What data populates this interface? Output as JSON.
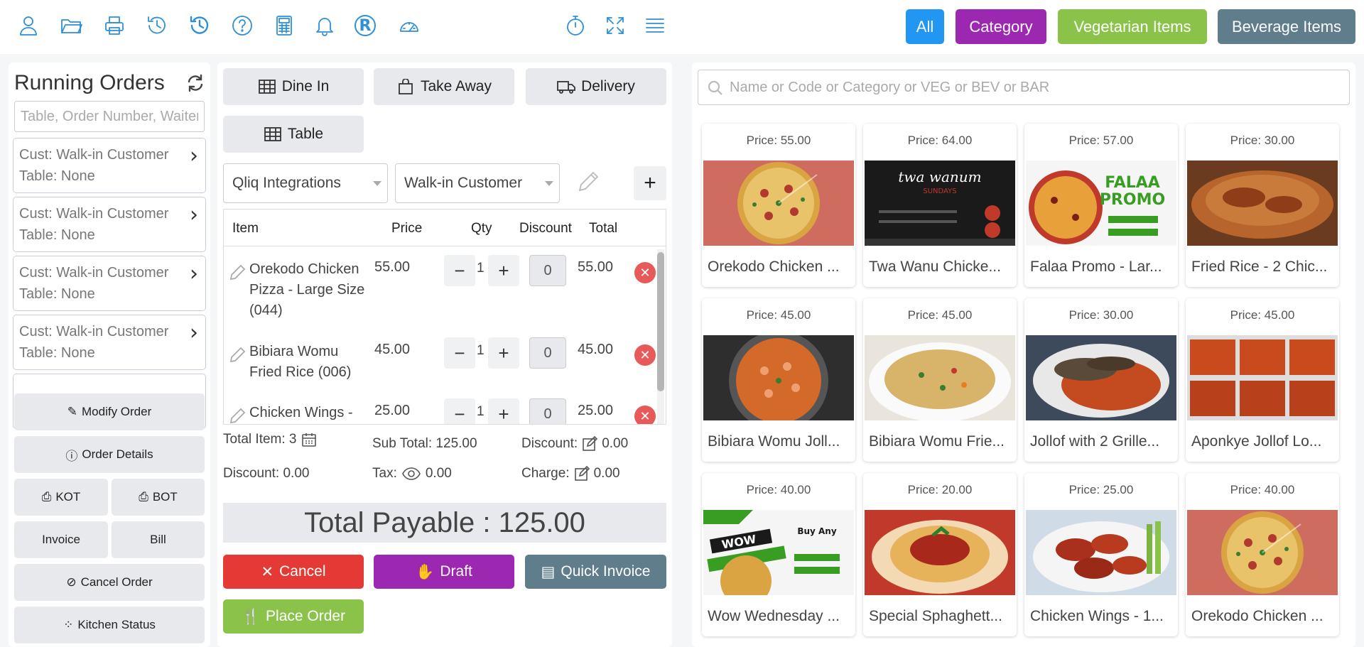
{
  "topbar": {
    "icons": [
      "user-icon",
      "folder-icon",
      "printer-icon",
      "history-icon",
      "history-alt-icon",
      "help-icon",
      "calculator-icon",
      "bell-icon",
      "registered-icon",
      "dashboard-icon",
      "timer-icon",
      "fullscreen-icon",
      "menu-icon"
    ],
    "filters": {
      "all": "All",
      "category": "Category",
      "veg": "Vegetarian Items",
      "bev": "Beverage Items"
    },
    "registered_glyph": "R"
  },
  "colors": {
    "accent": "#2f8fd8",
    "all": "#2196f3",
    "category": "#9c27b0",
    "veg": "#8bc34a",
    "bev": "#607d8b",
    "cancel": "#e53935",
    "draft": "#9c27b0",
    "quick": "#607d8b",
    "place": "#8bc34a"
  },
  "running": {
    "title": "Running Orders",
    "search_placeholder": "Table, Order Number, Waiter",
    "orders": [
      {
        "cust": "Cust: Walk-in Customer",
        "table": "Table: None"
      },
      {
        "cust": "Cust: Walk-in Customer",
        "table": "Table: None"
      },
      {
        "cust": "Cust: Walk-in Customer",
        "table": "Table: None"
      },
      {
        "cust": "Cust: Walk-in Customer",
        "table": "Table: None"
      }
    ],
    "actions": {
      "modify": "Modify Order",
      "details": "Order Details",
      "kot": "KOT",
      "bot": "BOT",
      "invoice": "Invoice",
      "bill": "Bill",
      "cancel": "Cancel Order",
      "kitchen": "Kitchen Status"
    }
  },
  "order": {
    "types": {
      "dine_in": "Dine In",
      "take_away": "Take Away",
      "delivery": "Delivery",
      "table": "Table"
    },
    "waiter_select": "Qliq Integrations",
    "customer_select": "Walk-in Customer",
    "headers": {
      "item": "Item",
      "price": "Price",
      "qty": "Qty",
      "discount": "Discount",
      "total": "Total"
    },
    "items": [
      {
        "name": "Orekodo Chicken Pizza - Large Size (044)",
        "price": "55.00",
        "qty": "1",
        "discount": "0",
        "total": "55.00"
      },
      {
        "name": "Bibiara Womu Fried Rice (006)",
        "price": "45.00",
        "qty": "1",
        "discount": "0",
        "total": "45.00"
      },
      {
        "name": "Chicken Wings - ",
        "price": "25.00",
        "qty": "1",
        "discount": "0",
        "total": "25.00"
      }
    ],
    "summary": {
      "total_item": "Total Item: 3",
      "sub_total": "Sub Total: 125.00",
      "discount_label": "Discount:",
      "discount_value": "0.00",
      "discount2": "Discount: 0.00",
      "tax_label": "Tax:",
      "tax_value": "0.00",
      "charge_label": "Charge:",
      "charge_value": "0.00"
    },
    "payable": "Total Payable : 125.00",
    "buttons": {
      "cancel": "Cancel",
      "draft": "Draft",
      "quick": "Quick Invoice",
      "place": "Place Order"
    }
  },
  "menu": {
    "search_placeholder": "Name or Code or Category or VEG or BEV or BAR",
    "products": [
      {
        "price": "Price: 55.00",
        "name": "Orekodo Chicken ...",
        "img": "pizza"
      },
      {
        "price": "Price: 64.00",
        "name": "Twa Wanu Chicke...",
        "img": "promo-dark"
      },
      {
        "price": "Price: 57.00",
        "name": "Falaa Promo - Lar...",
        "img": "promo-green"
      },
      {
        "price": "Price: 30.00",
        "name": "Fried Rice - 2 Chic...",
        "img": "friedrice"
      },
      {
        "price": "Price: 45.00",
        "name": "Bibiara Womu Joll...",
        "img": "jollof-pan"
      },
      {
        "price": "Price: 45.00",
        "name": "Bibiara Womu Frie...",
        "img": "friedrice-plate"
      },
      {
        "price": "Price: 30.00",
        "name": "Jollof with 2 Grille...",
        "img": "jollof-grilled"
      },
      {
        "price": "Price: 45.00",
        "name": "Aponkye Jollof Lo...",
        "img": "jollof-trays"
      },
      {
        "price": "Price: 40.00",
        "name": "Wow Wednesday ...",
        "img": "promo-wow"
      },
      {
        "price": "Price: 20.00",
        "name": "Special Sphaghett...",
        "img": "spaghetti"
      },
      {
        "price": "Price: 25.00",
        "name": "Chicken Wings - 1...",
        "img": "wings"
      },
      {
        "price": "Price: 40.00",
        "name": "Orekodo Chicken ...",
        "img": "pizza"
      }
    ]
  }
}
